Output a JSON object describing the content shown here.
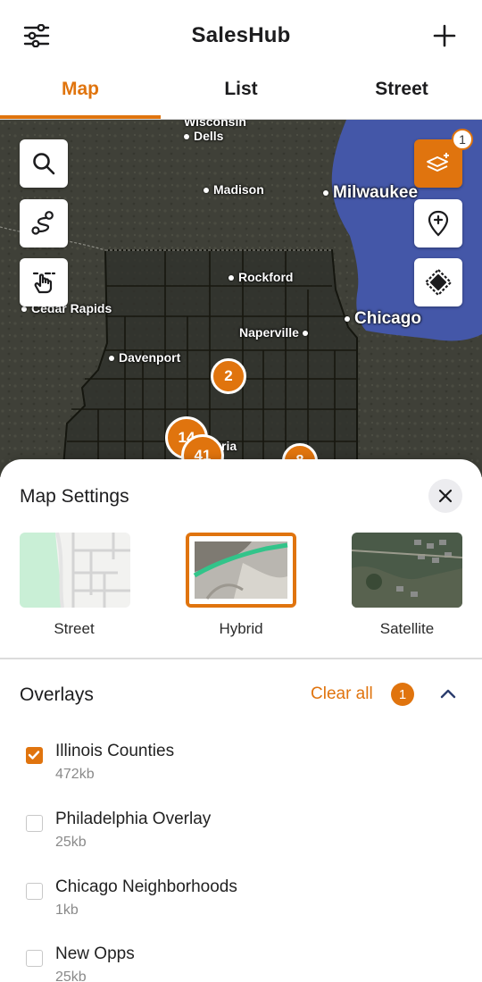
{
  "header": {
    "title": "SalesHub",
    "filter_icon": "sliders-icon",
    "add_icon": "plus-icon"
  },
  "tabs": [
    {
      "label": "Map",
      "active": true
    },
    {
      "label": "List",
      "active": false
    },
    {
      "label": "Street",
      "active": false
    }
  ],
  "map": {
    "cities": {
      "wisconsin_dells": "Wisconsin\nDells",
      "wisconsin": "Wisconsin",
      "dells": "Dells",
      "madison": "Madison",
      "milwaukee": "Milwaukee",
      "rockford": "Rockford",
      "cedar_rapids": "Cedar Rapids",
      "chicago": "Chicago",
      "naperville": "Naperville",
      "davenport": "Davenport",
      "peoria_fragment": "ria"
    },
    "layers_badge": "1",
    "clusters": [
      "2",
      "14",
      "41",
      "8"
    ],
    "tools": [
      "search-icon",
      "route-icon",
      "tap-select-icon",
      "layers-icon",
      "add-pin-icon",
      "directions-icon"
    ]
  },
  "sheet": {
    "title": "Map Settings",
    "styles": [
      {
        "label": "Street",
        "selected": false
      },
      {
        "label": "Hybrid",
        "selected": true
      },
      {
        "label": "Satellite",
        "selected": false
      }
    ],
    "overlays_title": "Overlays",
    "clear_all": "Clear all",
    "selected_count": "1",
    "items": [
      {
        "name": "Illinois Counties",
        "size": "472kb",
        "checked": true
      },
      {
        "name": "Philadelphia Overlay",
        "size": "25kb",
        "checked": false
      },
      {
        "name": "Chicago Neighborhoods",
        "size": "1kb",
        "checked": false
      },
      {
        "name": "New Opps",
        "size": "25kb",
        "checked": false
      }
    ]
  },
  "colors": {
    "accent": "#e0740e",
    "lake": "#4457a8"
  }
}
